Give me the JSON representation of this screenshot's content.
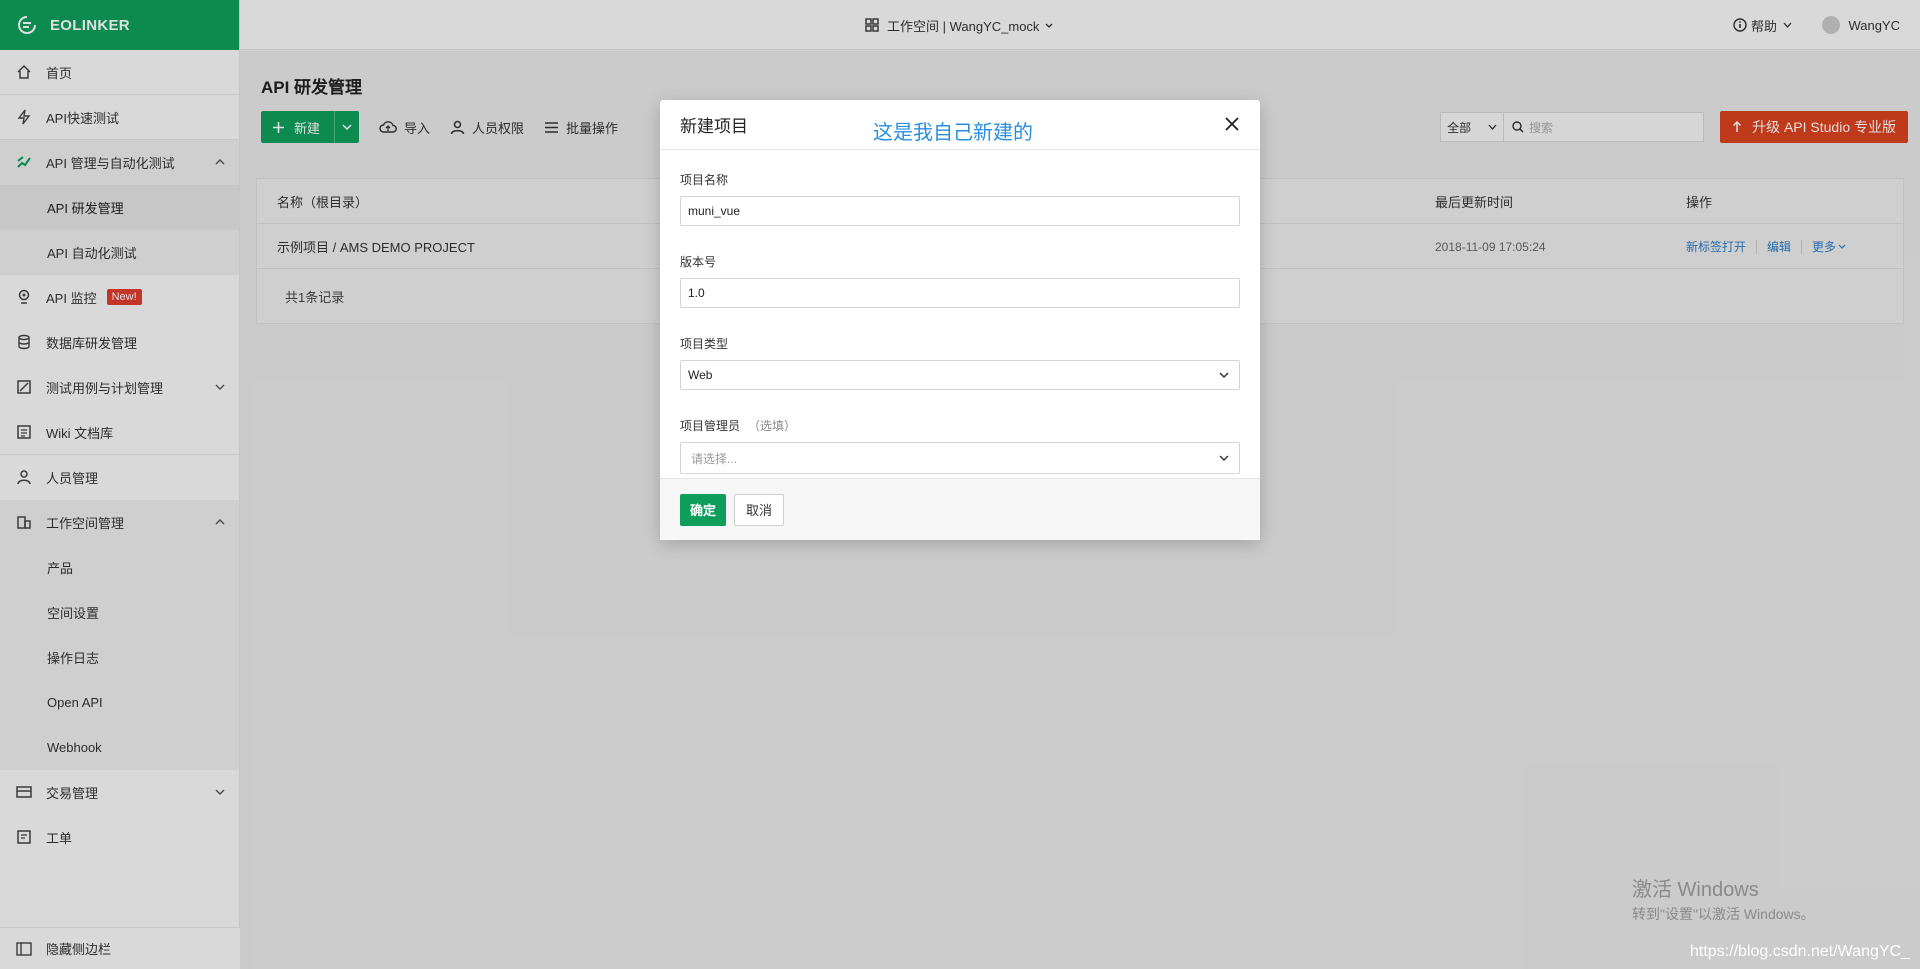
{
  "brand": {
    "name": "EOLINKER"
  },
  "sidebar": {
    "items": [
      {
        "label": "首页",
        "icon": "home-icon"
      },
      {
        "label": "API快速测试",
        "icon": "lightning-icon"
      },
      {
        "label": "API 管理与自动化测试",
        "icon": "api-icon",
        "expanded": true
      },
      {
        "label": "API 研发管理",
        "sub": true,
        "active": true
      },
      {
        "label": "API 自动化测试",
        "sub": true
      },
      {
        "label": "API 监控",
        "icon": "monitor-icon",
        "badge": "New!"
      },
      {
        "label": "数据库研发管理",
        "icon": "database-icon"
      },
      {
        "label": "测试用例与计划管理",
        "icon": "test-icon",
        "expandable": true
      },
      {
        "label": "Wiki 文档库",
        "icon": "wiki-icon"
      },
      {
        "label": "人员管理",
        "icon": "person-icon"
      },
      {
        "label": "工作空间管理",
        "icon": "building-icon",
        "expanded": true
      },
      {
        "label": "产品",
        "sub": true
      },
      {
        "label": "空间设置",
        "sub": true
      },
      {
        "label": "操作日志",
        "sub": true
      },
      {
        "label": "Open API",
        "sub": true
      },
      {
        "label": "Webhook",
        "sub": true
      },
      {
        "label": "交易管理",
        "icon": "card-icon",
        "expandable": true
      },
      {
        "label": "工单",
        "icon": "ticket-icon"
      }
    ],
    "hide_label": "隐藏侧边栏"
  },
  "header": {
    "workspace_label": "工作空间 | WangYC_mock",
    "help_label": "帮助",
    "user_name": "WangYC"
  },
  "page": {
    "title": "API 研发管理",
    "toolbar": {
      "new_label": "新建",
      "import_label": "导入",
      "permission_label": "人员权限",
      "batch_label": "批量操作"
    },
    "filter": {
      "selected": "全部",
      "search_placeholder": "搜索"
    },
    "upgrade_label": "升级 API Studio 专业版",
    "table": {
      "headers": {
        "name": "名称（根目录）",
        "updated": "最后更新时间",
        "ops": "操作"
      },
      "rows": [
        {
          "name": "示例项目 / AMS DEMO PROJECT",
          "updated": "2018-11-09 17:05:24",
          "op_open": "新标签打开",
          "op_edit": "编辑",
          "op_more": "更多"
        }
      ],
      "footer": "共1条记录"
    }
  },
  "modal": {
    "title": "新建项目",
    "annotation": "这是我自己新建的",
    "fields": {
      "name_label": "项目名称",
      "name_value": "muni_vue",
      "version_label": "版本号",
      "version_value": "1.0",
      "type_label": "项目类型",
      "type_value": "Web",
      "manager_label": "项目管理员",
      "manager_optional": "（选填）",
      "manager_placeholder": "请选择..."
    },
    "ok_label": "确定",
    "cancel_label": "取消"
  },
  "watermarks": {
    "windows_line1": "激活 Windows",
    "windows_line2": "转到\"设置\"以激活 Windows。",
    "csdn": "https://blog.csdn.net/WangYC_"
  },
  "colors": {
    "brand_green": "#0e9e5c",
    "upgrade_red": "#d9421e",
    "annotation_blue": "#2a8ee0",
    "link_blue": "#2b7bc6",
    "badge_red": "#e03d2f"
  }
}
